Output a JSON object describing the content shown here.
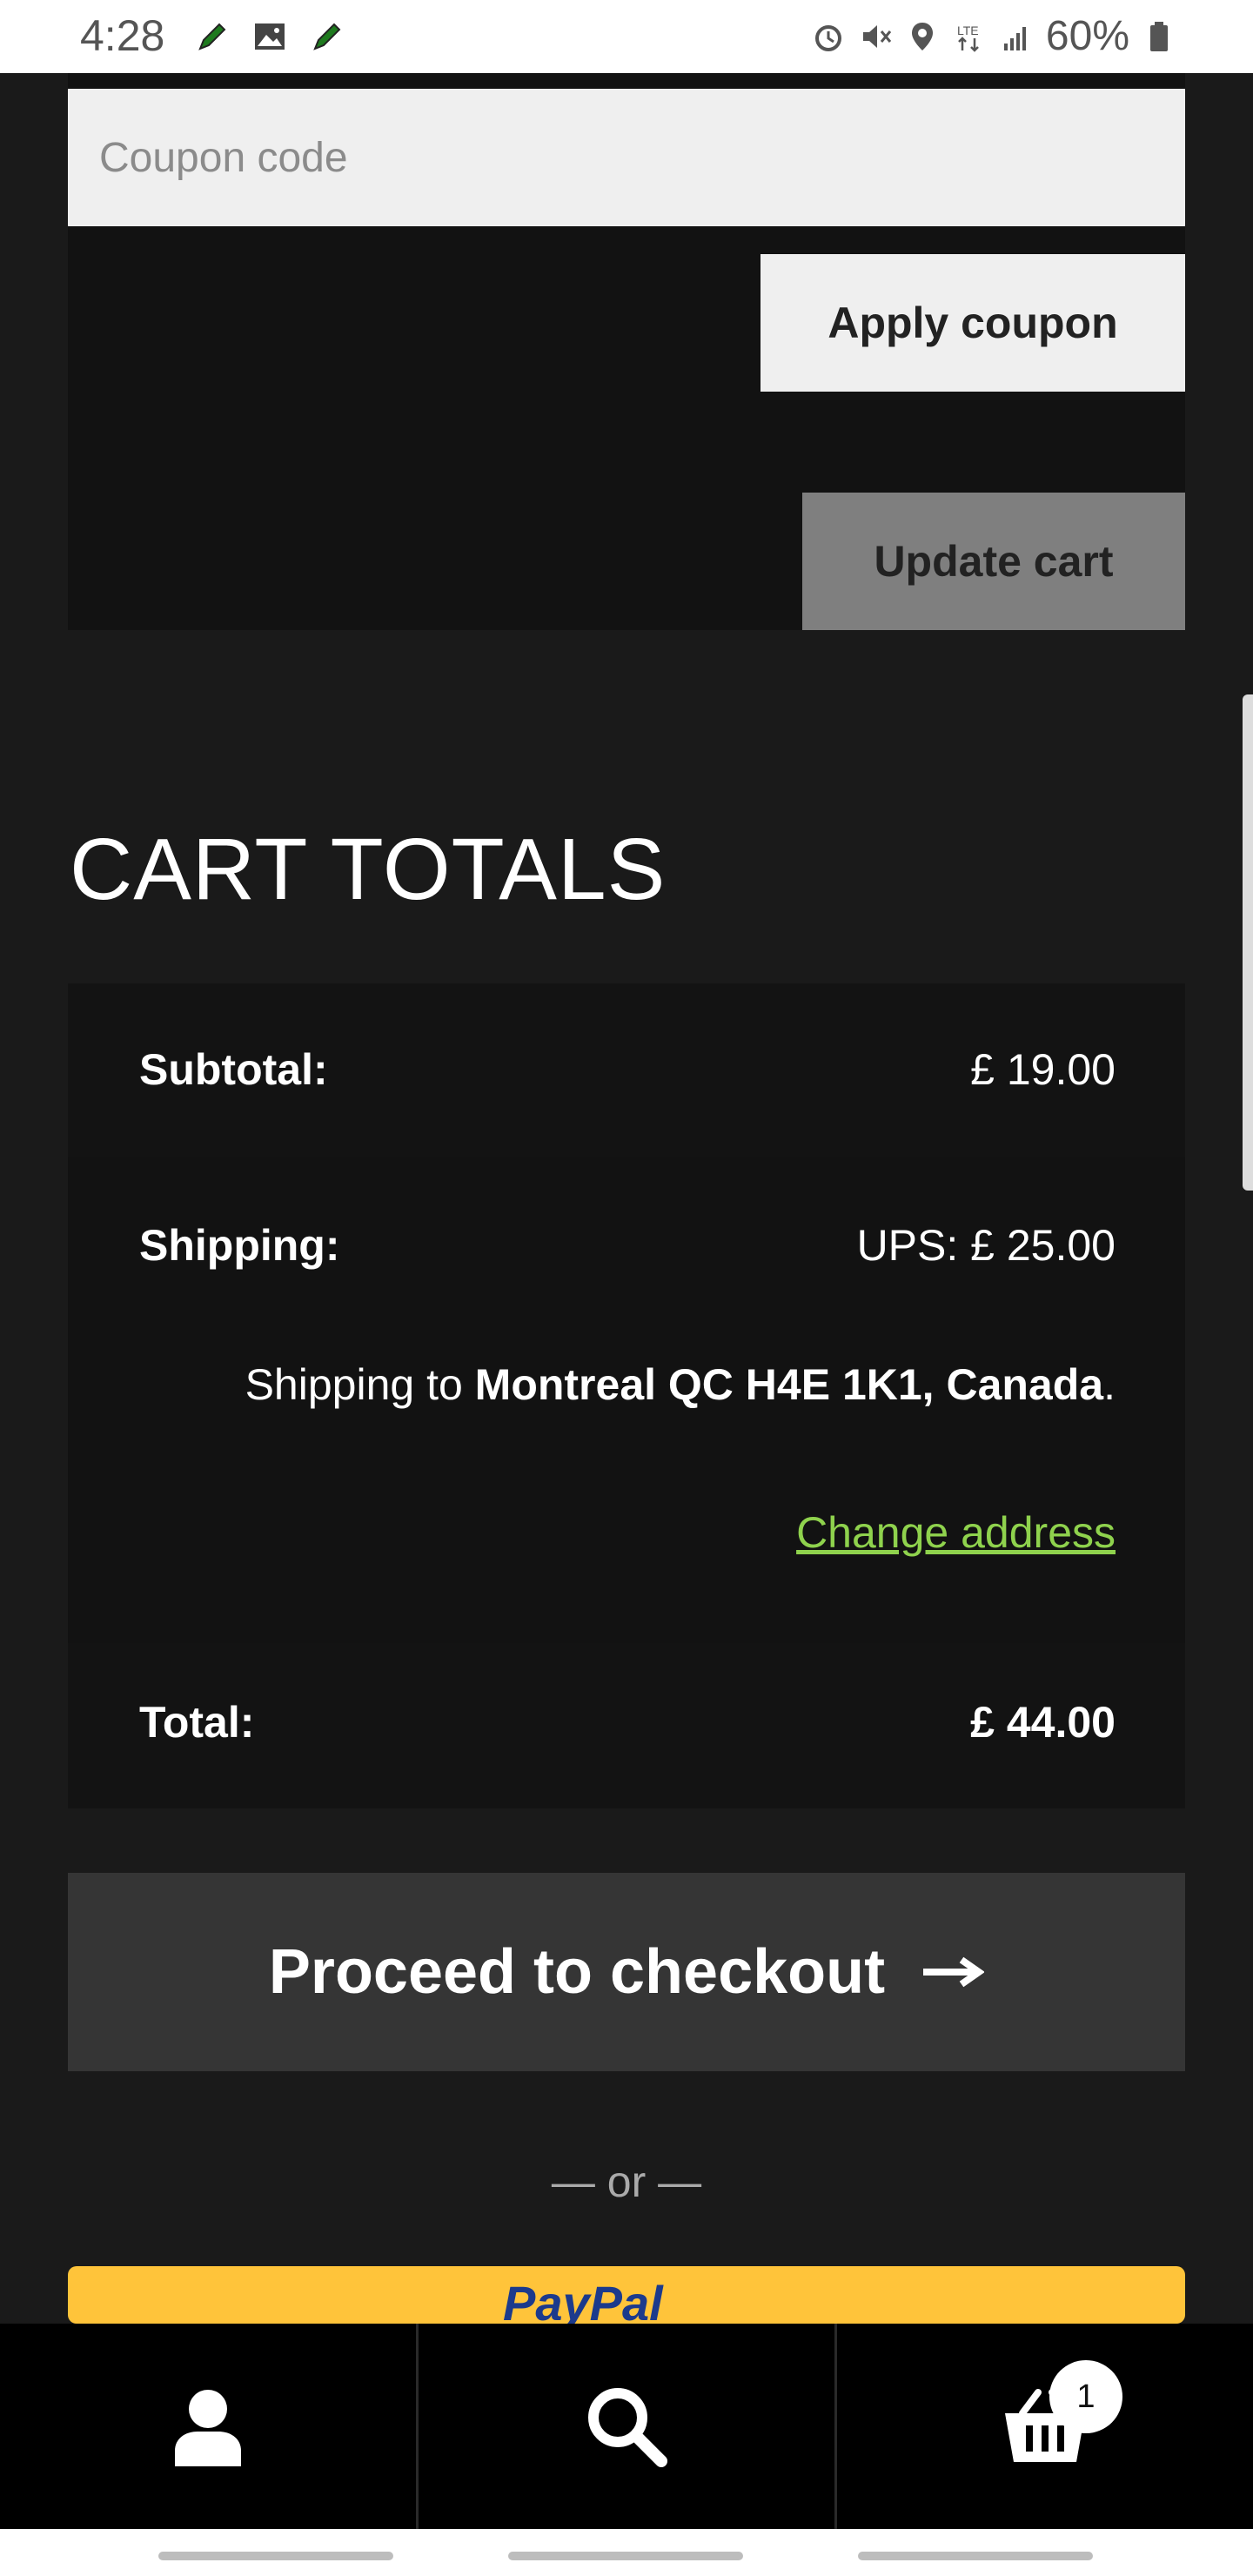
{
  "status_bar": {
    "time": "4:28",
    "battery": "60%",
    "network": "LTE"
  },
  "coupon": {
    "placeholder": "Coupon code",
    "apply_label": "Apply coupon",
    "update_label": "Update cart"
  },
  "cart_totals": {
    "heading": "CART TOTALS",
    "subtotal_label": "Subtotal:",
    "subtotal_value": "£ 19.00",
    "shipping_label": "Shipping:",
    "shipping_value": "UPS: £ 25.00",
    "shipping_to_prefix": "Shipping to ",
    "shipping_destination": "Montreal QC  H4E 1K1, Canada",
    "shipping_to_suffix": ".",
    "change_address": "Change address",
    "total_label": "Total:",
    "total_value": "£ 44.00"
  },
  "checkout": {
    "button_label": "Proceed to checkout",
    "or_text": "— or —",
    "paypal_label": "PayPal"
  },
  "bottom_nav": {
    "items": [
      "account-icon",
      "search-icon",
      "cart-icon"
    ],
    "cart_count": "1"
  },
  "colors": {
    "background": "#1a1a1a",
    "panel": "#121212",
    "link": "#8fd24d",
    "paypal": "#ffc43a"
  }
}
